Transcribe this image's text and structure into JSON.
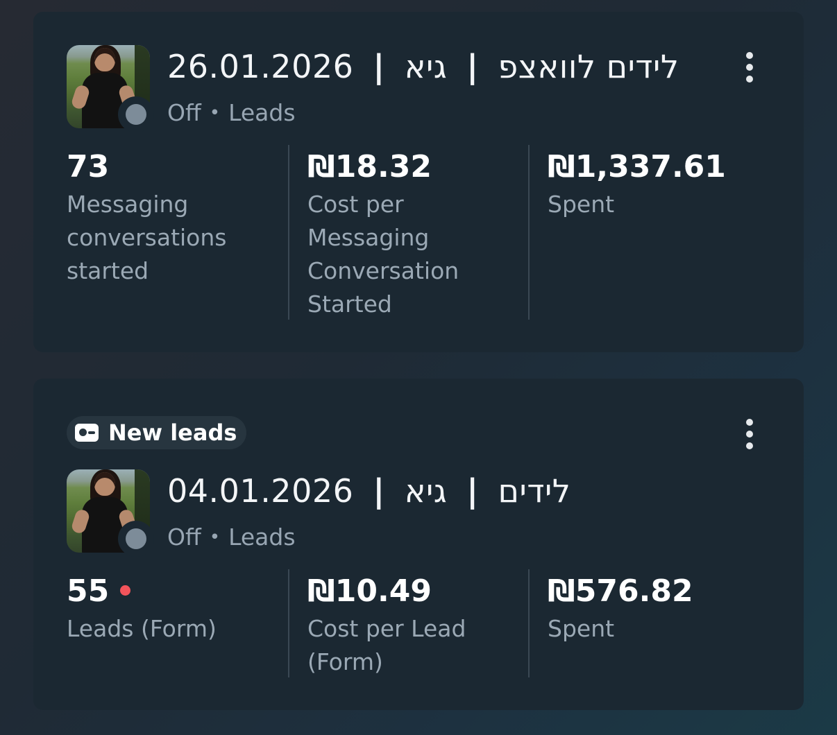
{
  "campaigns": [
    {
      "date": "26.01.2026",
      "name_part1": "גיא",
      "name_part2": "לידים לוואצפ",
      "separator": "|",
      "status": "Off",
      "objective": "Leads",
      "status_dot_color": "#7d8c99",
      "metrics": [
        {
          "value": "73",
          "label": "Messaging conversations started"
        },
        {
          "value": "₪18.32",
          "label": "Cost per Messaging Conversation Started"
        },
        {
          "value": "₪1,337.61",
          "label": "Spent"
        }
      ]
    },
    {
      "badge": "New leads",
      "date": "04.01.2026",
      "name_part1": "גיא",
      "name_part2": "לידים",
      "separator": "|",
      "status": "Off",
      "objective": "Leads",
      "status_dot_color": "#7d8c99",
      "new_indicator_color": "#f2545b",
      "metrics": [
        {
          "value": "55",
          "label": "Leads (Form)"
        },
        {
          "value": "₪10.49",
          "label": "Cost per Lead (Form)"
        },
        {
          "value": "₪576.82",
          "label": "Spent"
        }
      ]
    }
  ]
}
